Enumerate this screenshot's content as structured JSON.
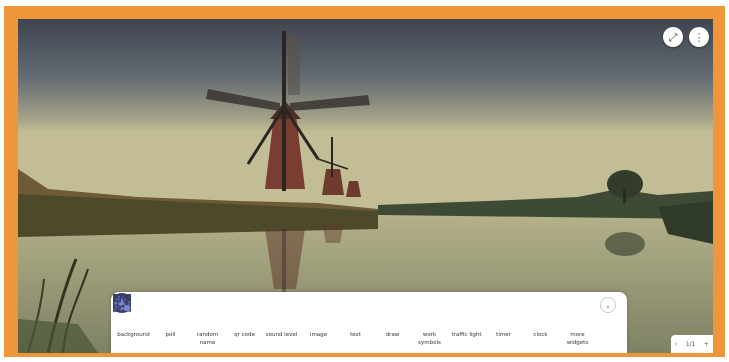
{
  "window": {
    "fullscreen_icon": "fullscreen-icon",
    "menu_icon": "more-vertical-icon"
  },
  "toolbar": {
    "items": [
      {
        "label": "background",
        "icon": "background-icon"
      },
      {
        "label": "poll",
        "icon": "poll-icon"
      },
      {
        "label": "random name",
        "icon": "random-name-icon"
      },
      {
        "label": "qr code",
        "icon": "qr-code-icon"
      },
      {
        "label": "sound level",
        "icon": "sound-level-icon"
      },
      {
        "label": "image",
        "icon": "image-icon"
      },
      {
        "label": "text",
        "icon": "text-icon"
      },
      {
        "label": "draw",
        "icon": "draw-icon"
      },
      {
        "label": "work symbols",
        "icon": "work-symbols-icon"
      },
      {
        "label": "traffic light",
        "icon": "traffic-light-icon"
      },
      {
        "label": "timer",
        "icon": "timer-icon"
      },
      {
        "label": "clock",
        "icon": "clock-icon"
      },
      {
        "label": "more widgets",
        "icon": "more-widgets-icon"
      }
    ],
    "collapse_icon": "chevron-down-icon"
  },
  "pager": {
    "prev": "‹",
    "page": "1/1",
    "add": "+"
  },
  "colors": {
    "frame": "#f0963a",
    "toolbar_bg": "#ffffff",
    "icon_stroke": "#3a3f6b",
    "icon_accent": "#7a86d6"
  }
}
